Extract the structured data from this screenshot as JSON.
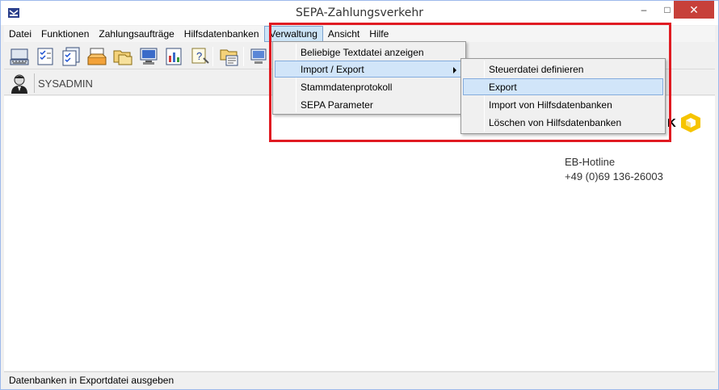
{
  "window": {
    "title": "SEPA-Zahlungsverkehr",
    "controls": {
      "minimize": "–",
      "maximize": "□",
      "close": "✕"
    }
  },
  "menubar": {
    "items": [
      "Datei",
      "Funktionen",
      "Zahlungsaufträge",
      "Hilfsdatenbanken",
      "Verwaltung",
      "Ansicht",
      "Hilfe"
    ],
    "active": "Verwaltung"
  },
  "toolbar": {
    "icons": [
      "keyboard-icon",
      "checklist-icon",
      "checklist-stack-icon",
      "inbox-icon",
      "folders-icon",
      "monitor-icon",
      "report-icon",
      "help-icon",
      "folder-list-icon",
      "computer-icon"
    ]
  },
  "user": {
    "name": "SYSADMIN"
  },
  "verwaltung_menu": {
    "items": [
      "Beliebige Textdatei anzeigen",
      "Import / Export",
      "Stammdatenprotokoll",
      "SEPA Parameter"
    ],
    "highlighted": "Import / Export"
  },
  "import_export_submenu": {
    "items": [
      "Steuerdatei definieren",
      "Export",
      "Import von Hilfsdatenbanken",
      "Löschen von Hilfsdatenbanken"
    ],
    "highlighted": "Export"
  },
  "branding": {
    "partial_text": "K",
    "hotline_label": "EB-Hotline",
    "hotline_number": "+49 (0)69 136-26003",
    "logo_color": "#f6c400"
  },
  "statusbar": {
    "text": "Datenbanken in Exportdatei ausgeben"
  },
  "colors": {
    "annotation": "#e01b22",
    "highlight": "#d1e5f9",
    "close": "#c7403a"
  }
}
